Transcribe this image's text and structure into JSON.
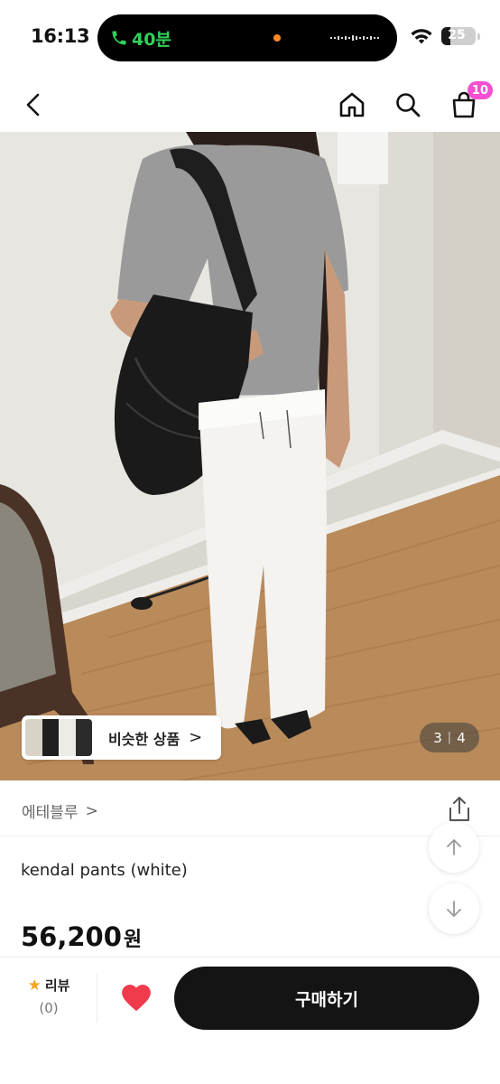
{
  "status_bar": {
    "time": "16:13",
    "call_duration": "40분",
    "battery_level": "25",
    "battery_fraction": 0.25
  },
  "nav": {
    "cart_count": "10"
  },
  "gallery": {
    "similar_label": "비슷한 상품",
    "similar_arrow": ">",
    "current_page": "3",
    "separator": "|",
    "total_pages": "4"
  },
  "product": {
    "brand": "에테블루",
    "brand_arrow": ">",
    "name": "kendal pants (white)",
    "price": "56,200",
    "price_unit": "원"
  },
  "bottom_bar": {
    "review_label": "리뷰",
    "review_count": "(0)",
    "buy_label": "구매하기"
  },
  "colors": {
    "accent_badge": "#f34fd0",
    "heart": "#ef3b4c",
    "buy_button": "#141414",
    "star": "#f5a623",
    "call_green": "#33d05c"
  },
  "icons": [
    "back-icon",
    "home-icon",
    "search-icon",
    "cart-icon",
    "share-icon",
    "arrow-up-icon",
    "arrow-down-icon",
    "star-icon",
    "heart-icon",
    "phone-icon",
    "wifi-icon"
  ]
}
